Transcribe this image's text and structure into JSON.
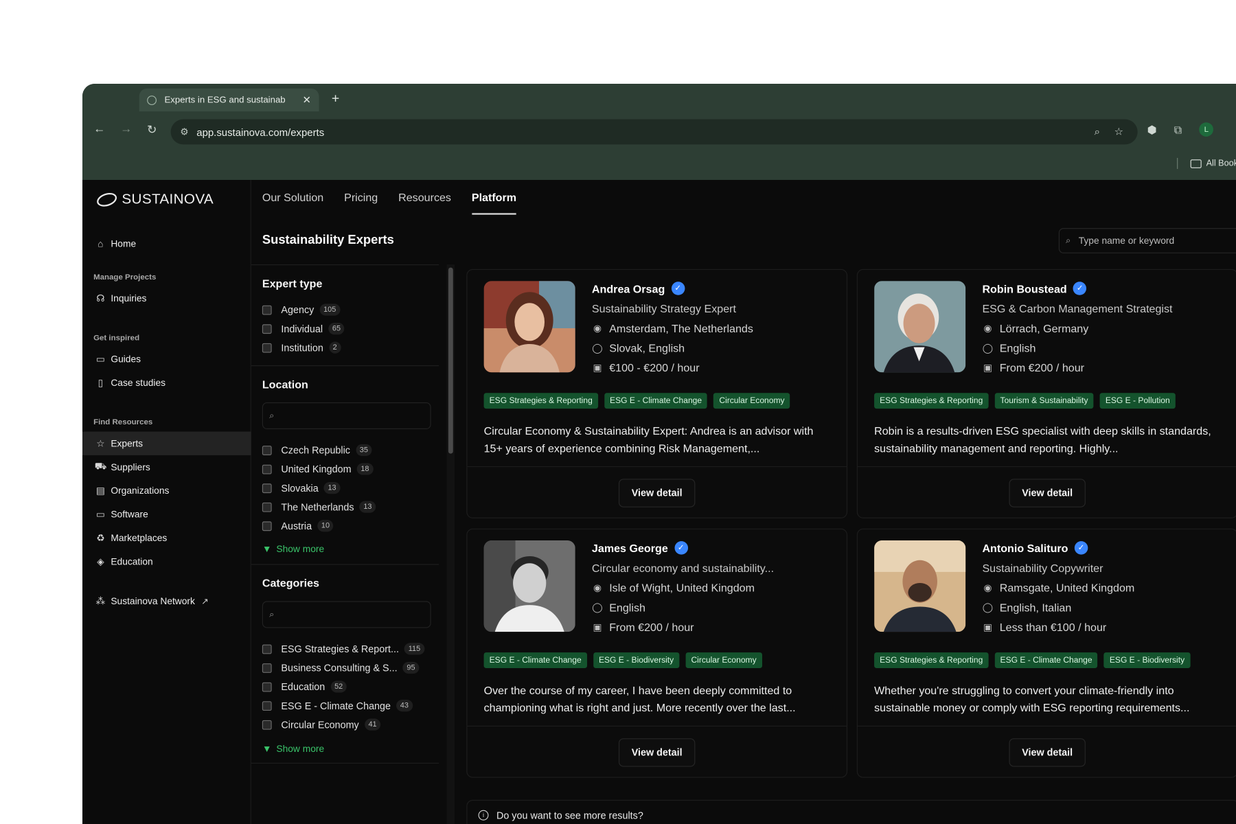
{
  "browser": {
    "tab_title": "Experts in ESG and sustainab",
    "url": "app.sustainova.com/experts",
    "bookmarks_label": "All Book",
    "profile_initial": "L"
  },
  "brand": {
    "name": "SUSTAINOVA"
  },
  "topnav": [
    "Our Solution",
    "Pricing",
    "Resources",
    "Platform"
  ],
  "topnav_active": "Platform",
  "sidebar": {
    "home": "Home",
    "sections": {
      "manage": "Manage Projects",
      "inspired": "Get inspired",
      "resources": "Find Resources"
    },
    "items": {
      "inquiries": "Inquiries",
      "guides": "Guides",
      "case_studies": "Case studies",
      "experts": "Experts",
      "suppliers": "Suppliers",
      "organizations": "Organizations",
      "software": "Software",
      "marketplaces": "Marketplaces",
      "education": "Education",
      "network": "Sustainova Network"
    }
  },
  "page": {
    "title": "Sustainability Experts",
    "search_placeholder": "Type name or keyword"
  },
  "filters": {
    "expert_type": {
      "title": "Expert type",
      "options": [
        {
          "label": "Agency",
          "count": "105"
        },
        {
          "label": "Individual",
          "count": "65"
        },
        {
          "label": "Institution",
          "count": "2"
        }
      ]
    },
    "location": {
      "title": "Location",
      "options": [
        {
          "label": "Czech Republic",
          "count": "35"
        },
        {
          "label": "United Kingdom",
          "count": "18"
        },
        {
          "label": "Slovakia",
          "count": "13"
        },
        {
          "label": "The Netherlands",
          "count": "13"
        },
        {
          "label": "Austria",
          "count": "10"
        }
      ],
      "show_more": "Show more"
    },
    "categories": {
      "title": "Categories",
      "options": [
        {
          "label": "ESG Strategies & Report...",
          "count": "115"
        },
        {
          "label": "Business Consulting & S...",
          "count": "95"
        },
        {
          "label": "Education",
          "count": "52"
        },
        {
          "label": "ESG E - Climate Change",
          "count": "43"
        },
        {
          "label": "Circular Economy",
          "count": "41"
        }
      ],
      "show_more": "Show more"
    }
  },
  "experts": [
    {
      "name": "Andrea Orsag",
      "role": "Sustainability Strategy Expert",
      "location": "Amsterdam, The Netherlands",
      "languages": "Slovak, English",
      "rate": "€100 - €200 / hour",
      "tags": [
        "ESG Strategies & Reporting",
        "ESG E - Climate Change",
        "Circular Economy"
      ],
      "description": "Circular Economy & Sustainability Expert: Andrea is an advisor with 15+ years of experience combining Risk Management,...",
      "button": "View detail"
    },
    {
      "name": "Robin Boustead",
      "role": "ESG & Carbon Management Strategist",
      "location": "Lörrach, Germany",
      "languages": "English",
      "rate": "From €200 / hour",
      "tags": [
        "ESG Strategies & Reporting",
        "Tourism & Sustainability",
        "ESG E - Pollution"
      ],
      "description": "Robin is a results-driven ESG specialist with deep skills in standards, sustainability management and reporting. Highly...",
      "button": "View detail"
    },
    {
      "name": "James George",
      "role": "Circular economy and sustainability...",
      "location": "Isle of Wight, United Kingdom",
      "languages": "English",
      "rate": "From €200 / hour",
      "tags": [
        "ESG E - Climate Change",
        "ESG E - Biodiversity",
        "Circular Economy"
      ],
      "description": "Over the course of my career, I have been deeply committed to championing what is right and just. More recently over the last...",
      "button": "View detail"
    },
    {
      "name": "Antonio Salituro",
      "role": "Sustainability Copywriter",
      "location": "Ramsgate, United Kingdom",
      "languages": "English, Italian",
      "rate": "Less than €100 / hour",
      "tags": [
        "ESG Strategies & Reporting",
        "ESG E - Climate Change",
        "ESG E - Biodiversity"
      ],
      "description": "Whether you're struggling to convert your climate-friendly into sustainable money or comply with ESG reporting requirements...",
      "button": "View detail"
    }
  ],
  "more_results": "Do you want to see more results?",
  "colors": {
    "tag_bg": "#14532d",
    "accent_green": "#3ac46a",
    "verified_blue": "#3a86ff",
    "chrome_bg": "#2d3e34"
  }
}
